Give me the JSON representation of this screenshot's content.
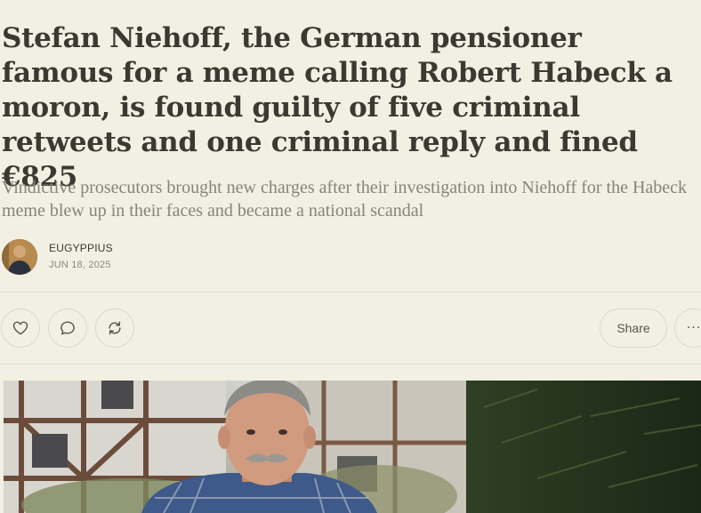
{
  "post": {
    "title": "Stefan Niehoff, the German pensioner famous for a meme calling Robert Habeck a moron, is found guilty of five criminal retweets and one criminal reply and fined €825",
    "subtitle": "Vindictive prosecutors brought new charges after their investigation into Niehoff for the Habeck meme blew up in their faces and became a national scandal",
    "author": "EUGYPPIUS",
    "date": "JUN 18, 2025"
  },
  "actions": {
    "like_icon": "heart-icon",
    "comment_icon": "comment-icon",
    "restack_icon": "restack-icon",
    "share_label": "Share",
    "more_label": "···"
  },
  "colors": {
    "background": "#f1f0e2",
    "title": "#3a3a33",
    "subtitle": "#85847c",
    "divider": "#dcdbcb"
  }
}
